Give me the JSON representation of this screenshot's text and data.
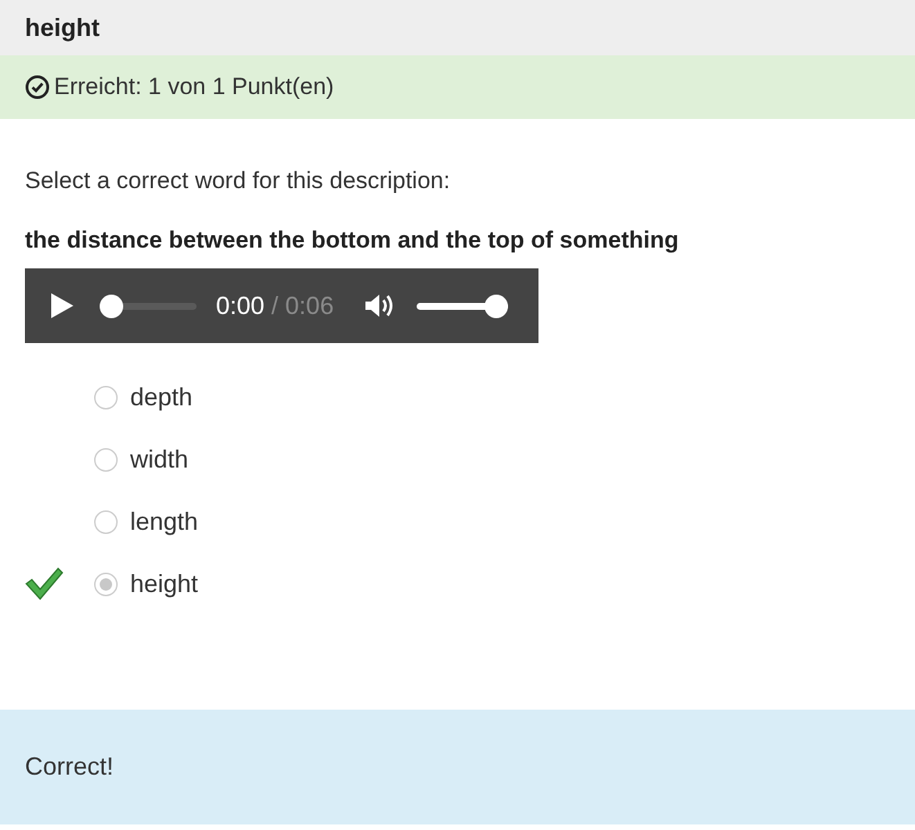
{
  "question_title": "height",
  "score": {
    "text": "Erreicht: 1 von 1 Punkt(en)"
  },
  "instruction": "Select a correct word for this description:",
  "description": "the distance between the bottom and the top of something",
  "audio": {
    "current": "0:00",
    "duration": "/ 0:06",
    "progress": {
      "level": 0.0
    },
    "volume": {
      "level": 1.0
    }
  },
  "options": [
    {
      "label": "depth",
      "selected": false,
      "correct": false
    },
    {
      "label": "width",
      "selected": false,
      "correct": false
    },
    {
      "label": "length",
      "selected": false,
      "correct": false
    },
    {
      "label": "height",
      "selected": true,
      "correct": true
    }
  ],
  "feedback": "Correct!"
}
